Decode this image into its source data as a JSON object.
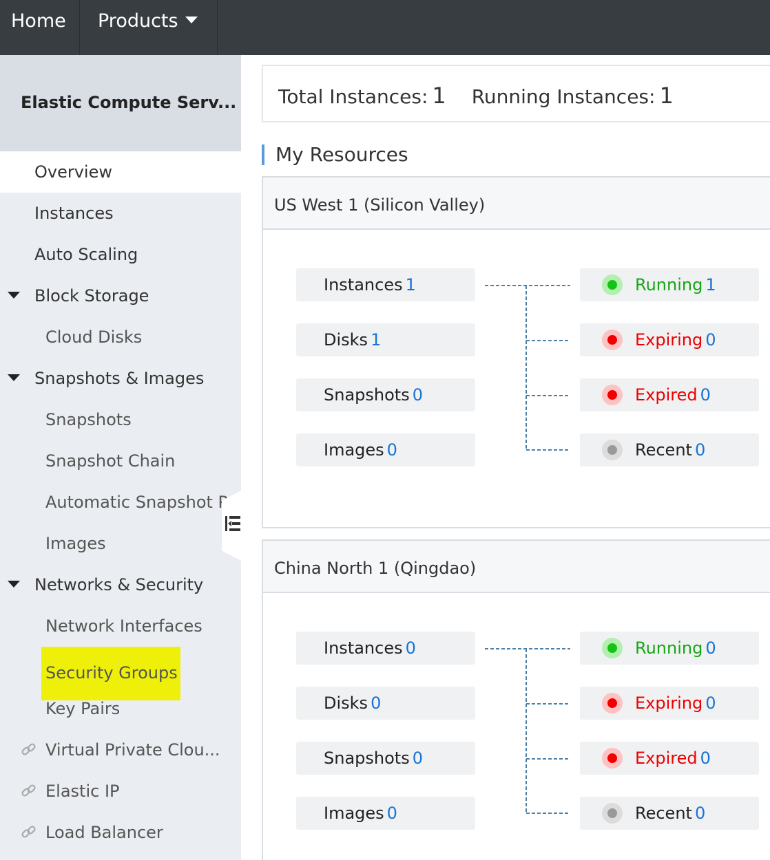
{
  "topnav": {
    "home": "Home",
    "products": "Products"
  },
  "sidebar": {
    "title": "Elastic Compute Serv...",
    "items": [
      {
        "label": "Overview"
      },
      {
        "label": "Instances"
      },
      {
        "label": "Auto Scaling"
      },
      {
        "label": "Block Storage"
      },
      {
        "label": "Cloud Disks"
      },
      {
        "label": "Snapshots & Images"
      },
      {
        "label": "Snapshots"
      },
      {
        "label": "Snapshot Chain"
      },
      {
        "label": "Automatic Snapshot P..."
      },
      {
        "label": "Images"
      },
      {
        "label": "Networks & Security"
      },
      {
        "label": "Network Interfaces"
      },
      {
        "label": "Security Groups"
      },
      {
        "label": "Key Pairs"
      },
      {
        "label": "Virtual Private Clou..."
      },
      {
        "label": "Elastic IP"
      },
      {
        "label": "Load Balancer"
      }
    ]
  },
  "summary": {
    "total_label": "Total Instances:",
    "total_value": "1",
    "running_label": "Running Instances:",
    "running_value": "1"
  },
  "section_title": "My Resources",
  "regions": [
    {
      "name": "US West 1 (Silicon Valley)",
      "resources": [
        {
          "label": "Instances",
          "count": "1"
        },
        {
          "label": "Disks",
          "count": "1"
        },
        {
          "label": "Snapshots",
          "count": "0"
        },
        {
          "label": "Images",
          "count": "0"
        }
      ],
      "statuses": [
        {
          "label": "Running",
          "count": "1"
        },
        {
          "label": "Expiring",
          "count": "0"
        },
        {
          "label": "Expired",
          "count": "0"
        },
        {
          "label": "Recent",
          "count": "0"
        }
      ]
    },
    {
      "name": "China North 1 (Qingdao)",
      "resources": [
        {
          "label": "Instances",
          "count": "0"
        },
        {
          "label": "Disks",
          "count": "0"
        },
        {
          "label": "Snapshots",
          "count": "0"
        },
        {
          "label": "Images",
          "count": "0"
        }
      ],
      "statuses": [
        {
          "label": "Running",
          "count": "0"
        },
        {
          "label": "Expiring",
          "count": "0"
        },
        {
          "label": "Expired",
          "count": "0"
        },
        {
          "label": "Recent",
          "count": "0"
        }
      ]
    }
  ],
  "colors": {
    "topbar": "#373d41",
    "sidebar": "#eaedf1",
    "link": "#1a73d4",
    "running": "#16a616",
    "expiring": "#ee0000",
    "highlight": "#eef00a"
  }
}
